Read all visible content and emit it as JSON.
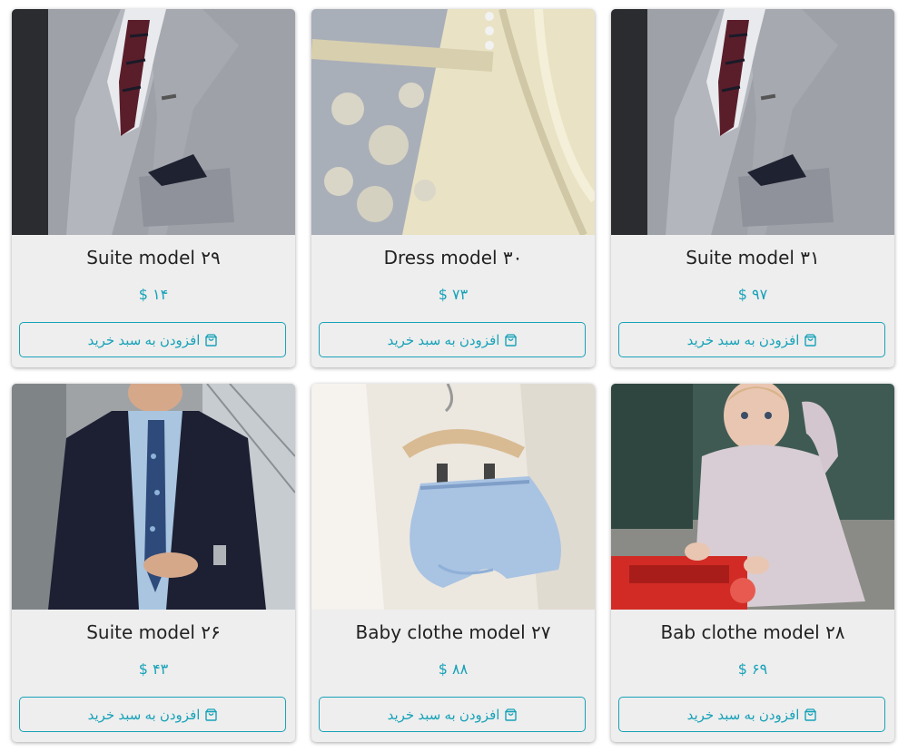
{
  "products": [
    {
      "title": "Suite model ۲۹",
      "price": "$ ۱۴",
      "cart_label": "افزودن به سبد خرید",
      "image": "grey-suit-photo"
    },
    {
      "title": "Dress model ۳۰",
      "price": "$ ۷۳",
      "cart_label": "افزودن به سبد خرید",
      "image": "lace-dress-photo"
    },
    {
      "title": "Suite model ۳۱",
      "price": "$ ۹۷",
      "cart_label": "افزودن به سبد خرید",
      "image": "grey-suit-photo"
    },
    {
      "title": "Suite model ۲۶",
      "price": "$ ۴۳",
      "cart_label": "افزودن به سبد خرید",
      "image": "navy-suit-photo"
    },
    {
      "title": "Baby clothe model ۲۷",
      "price": "$ ۸۸",
      "cart_label": "افزودن به سبد خرید",
      "image": "baby-shorts-photo"
    },
    {
      "title": "Bab clothe model ۲۸",
      "price": "$ ۶۹",
      "cart_label": "افزودن به سبد خرید",
      "image": "baby-toy-photo"
    }
  ],
  "colors": {
    "accent": "#17a2b8",
    "card_background": "#eeeeee",
    "title_text": "#222222"
  },
  "icons": {
    "cart_button": "shopping-bag-icon"
  }
}
